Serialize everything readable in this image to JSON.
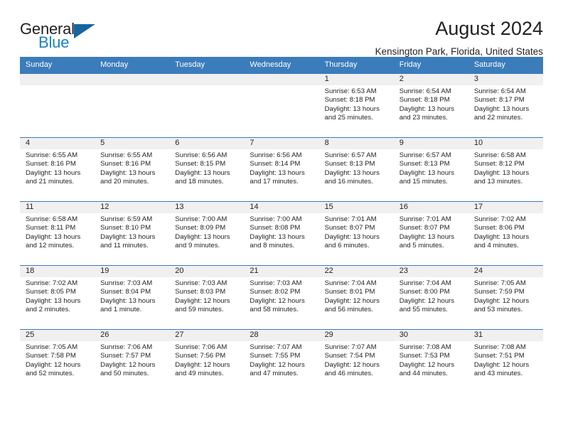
{
  "brand": {
    "name_part1": "General",
    "name_part2": "Blue",
    "triangle_color": "#15659f",
    "blue_text_color": "#1b7fc4"
  },
  "header": {
    "title": "August 2024",
    "location": "Kensington Park, Florida, United States"
  },
  "theme": {
    "header_bar_color": "#3b7cbb",
    "day_number_band_color": "#f0f0f0",
    "text_color": "#231f20"
  },
  "weekdays": [
    "Sunday",
    "Monday",
    "Tuesday",
    "Wednesday",
    "Thursday",
    "Friday",
    "Saturday"
  ],
  "weeks": [
    [
      {
        "day": "",
        "sunrise": "",
        "sunset": "",
        "daylight_line1": "",
        "daylight_line2": ""
      },
      {
        "day": "",
        "sunrise": "",
        "sunset": "",
        "daylight_line1": "",
        "daylight_line2": ""
      },
      {
        "day": "",
        "sunrise": "",
        "sunset": "",
        "daylight_line1": "",
        "daylight_line2": ""
      },
      {
        "day": "",
        "sunrise": "",
        "sunset": "",
        "daylight_line1": "",
        "daylight_line2": ""
      },
      {
        "day": "1",
        "sunrise": "Sunrise: 6:53 AM",
        "sunset": "Sunset: 8:18 PM",
        "daylight_line1": "Daylight: 13 hours",
        "daylight_line2": "and 25 minutes."
      },
      {
        "day": "2",
        "sunrise": "Sunrise: 6:54 AM",
        "sunset": "Sunset: 8:18 PM",
        "daylight_line1": "Daylight: 13 hours",
        "daylight_line2": "and 23 minutes."
      },
      {
        "day": "3",
        "sunrise": "Sunrise: 6:54 AM",
        "sunset": "Sunset: 8:17 PM",
        "daylight_line1": "Daylight: 13 hours",
        "daylight_line2": "and 22 minutes."
      }
    ],
    [
      {
        "day": "4",
        "sunrise": "Sunrise: 6:55 AM",
        "sunset": "Sunset: 8:16 PM",
        "daylight_line1": "Daylight: 13 hours",
        "daylight_line2": "and 21 minutes."
      },
      {
        "day": "5",
        "sunrise": "Sunrise: 6:55 AM",
        "sunset": "Sunset: 8:16 PM",
        "daylight_line1": "Daylight: 13 hours",
        "daylight_line2": "and 20 minutes."
      },
      {
        "day": "6",
        "sunrise": "Sunrise: 6:56 AM",
        "sunset": "Sunset: 8:15 PM",
        "daylight_line1": "Daylight: 13 hours",
        "daylight_line2": "and 18 minutes."
      },
      {
        "day": "7",
        "sunrise": "Sunrise: 6:56 AM",
        "sunset": "Sunset: 8:14 PM",
        "daylight_line1": "Daylight: 13 hours",
        "daylight_line2": "and 17 minutes."
      },
      {
        "day": "8",
        "sunrise": "Sunrise: 6:57 AM",
        "sunset": "Sunset: 8:13 PM",
        "daylight_line1": "Daylight: 13 hours",
        "daylight_line2": "and 16 minutes."
      },
      {
        "day": "9",
        "sunrise": "Sunrise: 6:57 AM",
        "sunset": "Sunset: 8:13 PM",
        "daylight_line1": "Daylight: 13 hours",
        "daylight_line2": "and 15 minutes."
      },
      {
        "day": "10",
        "sunrise": "Sunrise: 6:58 AM",
        "sunset": "Sunset: 8:12 PM",
        "daylight_line1": "Daylight: 13 hours",
        "daylight_line2": "and 13 minutes."
      }
    ],
    [
      {
        "day": "11",
        "sunrise": "Sunrise: 6:58 AM",
        "sunset": "Sunset: 8:11 PM",
        "daylight_line1": "Daylight: 13 hours",
        "daylight_line2": "and 12 minutes."
      },
      {
        "day": "12",
        "sunrise": "Sunrise: 6:59 AM",
        "sunset": "Sunset: 8:10 PM",
        "daylight_line1": "Daylight: 13 hours",
        "daylight_line2": "and 11 minutes."
      },
      {
        "day": "13",
        "sunrise": "Sunrise: 7:00 AM",
        "sunset": "Sunset: 8:09 PM",
        "daylight_line1": "Daylight: 13 hours",
        "daylight_line2": "and 9 minutes."
      },
      {
        "day": "14",
        "sunrise": "Sunrise: 7:00 AM",
        "sunset": "Sunset: 8:08 PM",
        "daylight_line1": "Daylight: 13 hours",
        "daylight_line2": "and 8 minutes."
      },
      {
        "day": "15",
        "sunrise": "Sunrise: 7:01 AM",
        "sunset": "Sunset: 8:07 PM",
        "daylight_line1": "Daylight: 13 hours",
        "daylight_line2": "and 6 minutes."
      },
      {
        "day": "16",
        "sunrise": "Sunrise: 7:01 AM",
        "sunset": "Sunset: 8:07 PM",
        "daylight_line1": "Daylight: 13 hours",
        "daylight_line2": "and 5 minutes."
      },
      {
        "day": "17",
        "sunrise": "Sunrise: 7:02 AM",
        "sunset": "Sunset: 8:06 PM",
        "daylight_line1": "Daylight: 13 hours",
        "daylight_line2": "and 4 minutes."
      }
    ],
    [
      {
        "day": "18",
        "sunrise": "Sunrise: 7:02 AM",
        "sunset": "Sunset: 8:05 PM",
        "daylight_line1": "Daylight: 13 hours",
        "daylight_line2": "and 2 minutes."
      },
      {
        "day": "19",
        "sunrise": "Sunrise: 7:03 AM",
        "sunset": "Sunset: 8:04 PM",
        "daylight_line1": "Daylight: 13 hours",
        "daylight_line2": "and 1 minute."
      },
      {
        "day": "20",
        "sunrise": "Sunrise: 7:03 AM",
        "sunset": "Sunset: 8:03 PM",
        "daylight_line1": "Daylight: 12 hours",
        "daylight_line2": "and 59 minutes."
      },
      {
        "day": "21",
        "sunrise": "Sunrise: 7:03 AM",
        "sunset": "Sunset: 8:02 PM",
        "daylight_line1": "Daylight: 12 hours",
        "daylight_line2": "and 58 minutes."
      },
      {
        "day": "22",
        "sunrise": "Sunrise: 7:04 AM",
        "sunset": "Sunset: 8:01 PM",
        "daylight_line1": "Daylight: 12 hours",
        "daylight_line2": "and 56 minutes."
      },
      {
        "day": "23",
        "sunrise": "Sunrise: 7:04 AM",
        "sunset": "Sunset: 8:00 PM",
        "daylight_line1": "Daylight: 12 hours",
        "daylight_line2": "and 55 minutes."
      },
      {
        "day": "24",
        "sunrise": "Sunrise: 7:05 AM",
        "sunset": "Sunset: 7:59 PM",
        "daylight_line1": "Daylight: 12 hours",
        "daylight_line2": "and 53 minutes."
      }
    ],
    [
      {
        "day": "25",
        "sunrise": "Sunrise: 7:05 AM",
        "sunset": "Sunset: 7:58 PM",
        "daylight_line1": "Daylight: 12 hours",
        "daylight_line2": "and 52 minutes."
      },
      {
        "day": "26",
        "sunrise": "Sunrise: 7:06 AM",
        "sunset": "Sunset: 7:57 PM",
        "daylight_line1": "Daylight: 12 hours",
        "daylight_line2": "and 50 minutes."
      },
      {
        "day": "27",
        "sunrise": "Sunrise: 7:06 AM",
        "sunset": "Sunset: 7:56 PM",
        "daylight_line1": "Daylight: 12 hours",
        "daylight_line2": "and 49 minutes."
      },
      {
        "day": "28",
        "sunrise": "Sunrise: 7:07 AM",
        "sunset": "Sunset: 7:55 PM",
        "daylight_line1": "Daylight: 12 hours",
        "daylight_line2": "and 47 minutes."
      },
      {
        "day": "29",
        "sunrise": "Sunrise: 7:07 AM",
        "sunset": "Sunset: 7:54 PM",
        "daylight_line1": "Daylight: 12 hours",
        "daylight_line2": "and 46 minutes."
      },
      {
        "day": "30",
        "sunrise": "Sunrise: 7:08 AM",
        "sunset": "Sunset: 7:53 PM",
        "daylight_line1": "Daylight: 12 hours",
        "daylight_line2": "and 44 minutes."
      },
      {
        "day": "31",
        "sunrise": "Sunrise: 7:08 AM",
        "sunset": "Sunset: 7:51 PM",
        "daylight_line1": "Daylight: 12 hours",
        "daylight_line2": "and 43 minutes."
      }
    ]
  ]
}
